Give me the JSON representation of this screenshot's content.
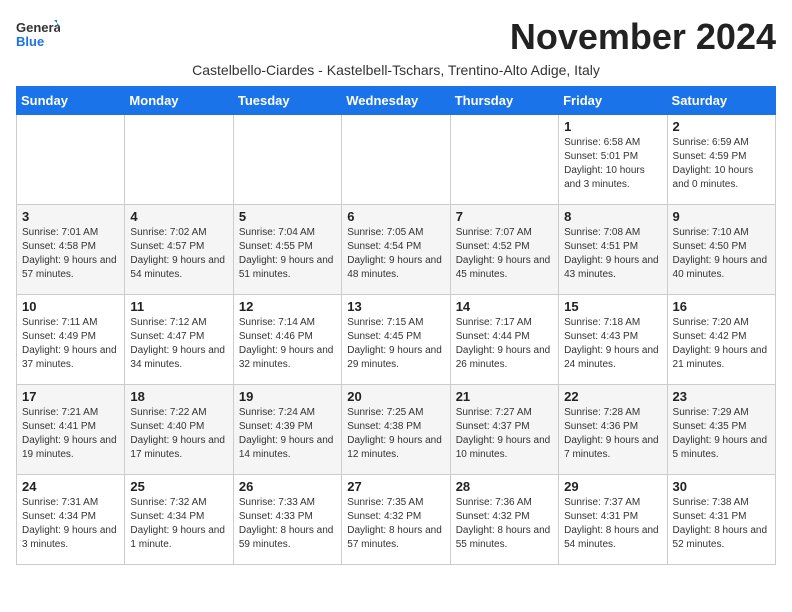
{
  "logo": {
    "text_general": "General",
    "text_blue": "Blue"
  },
  "title": "November 2024",
  "subtitle": "Castelbello-Ciardes - Kastelbell-Tschars, Trentino-Alto Adige, Italy",
  "headers": [
    "Sunday",
    "Monday",
    "Tuesday",
    "Wednesday",
    "Thursday",
    "Friday",
    "Saturday"
  ],
  "weeks": [
    [
      {
        "day": "",
        "info": ""
      },
      {
        "day": "",
        "info": ""
      },
      {
        "day": "",
        "info": ""
      },
      {
        "day": "",
        "info": ""
      },
      {
        "day": "",
        "info": ""
      },
      {
        "day": "1",
        "info": "Sunrise: 6:58 AM\nSunset: 5:01 PM\nDaylight: 10 hours and 3 minutes."
      },
      {
        "day": "2",
        "info": "Sunrise: 6:59 AM\nSunset: 4:59 PM\nDaylight: 10 hours and 0 minutes."
      }
    ],
    [
      {
        "day": "3",
        "info": "Sunrise: 7:01 AM\nSunset: 4:58 PM\nDaylight: 9 hours and 57 minutes."
      },
      {
        "day": "4",
        "info": "Sunrise: 7:02 AM\nSunset: 4:57 PM\nDaylight: 9 hours and 54 minutes."
      },
      {
        "day": "5",
        "info": "Sunrise: 7:04 AM\nSunset: 4:55 PM\nDaylight: 9 hours and 51 minutes."
      },
      {
        "day": "6",
        "info": "Sunrise: 7:05 AM\nSunset: 4:54 PM\nDaylight: 9 hours and 48 minutes."
      },
      {
        "day": "7",
        "info": "Sunrise: 7:07 AM\nSunset: 4:52 PM\nDaylight: 9 hours and 45 minutes."
      },
      {
        "day": "8",
        "info": "Sunrise: 7:08 AM\nSunset: 4:51 PM\nDaylight: 9 hours and 43 minutes."
      },
      {
        "day": "9",
        "info": "Sunrise: 7:10 AM\nSunset: 4:50 PM\nDaylight: 9 hours and 40 minutes."
      }
    ],
    [
      {
        "day": "10",
        "info": "Sunrise: 7:11 AM\nSunset: 4:49 PM\nDaylight: 9 hours and 37 minutes."
      },
      {
        "day": "11",
        "info": "Sunrise: 7:12 AM\nSunset: 4:47 PM\nDaylight: 9 hours and 34 minutes."
      },
      {
        "day": "12",
        "info": "Sunrise: 7:14 AM\nSunset: 4:46 PM\nDaylight: 9 hours and 32 minutes."
      },
      {
        "day": "13",
        "info": "Sunrise: 7:15 AM\nSunset: 4:45 PM\nDaylight: 9 hours and 29 minutes."
      },
      {
        "day": "14",
        "info": "Sunrise: 7:17 AM\nSunset: 4:44 PM\nDaylight: 9 hours and 26 minutes."
      },
      {
        "day": "15",
        "info": "Sunrise: 7:18 AM\nSunset: 4:43 PM\nDaylight: 9 hours and 24 minutes."
      },
      {
        "day": "16",
        "info": "Sunrise: 7:20 AM\nSunset: 4:42 PM\nDaylight: 9 hours and 21 minutes."
      }
    ],
    [
      {
        "day": "17",
        "info": "Sunrise: 7:21 AM\nSunset: 4:41 PM\nDaylight: 9 hours and 19 minutes."
      },
      {
        "day": "18",
        "info": "Sunrise: 7:22 AM\nSunset: 4:40 PM\nDaylight: 9 hours and 17 minutes."
      },
      {
        "day": "19",
        "info": "Sunrise: 7:24 AM\nSunset: 4:39 PM\nDaylight: 9 hours and 14 minutes."
      },
      {
        "day": "20",
        "info": "Sunrise: 7:25 AM\nSunset: 4:38 PM\nDaylight: 9 hours and 12 minutes."
      },
      {
        "day": "21",
        "info": "Sunrise: 7:27 AM\nSunset: 4:37 PM\nDaylight: 9 hours and 10 minutes."
      },
      {
        "day": "22",
        "info": "Sunrise: 7:28 AM\nSunset: 4:36 PM\nDaylight: 9 hours and 7 minutes."
      },
      {
        "day": "23",
        "info": "Sunrise: 7:29 AM\nSunset: 4:35 PM\nDaylight: 9 hours and 5 minutes."
      }
    ],
    [
      {
        "day": "24",
        "info": "Sunrise: 7:31 AM\nSunset: 4:34 PM\nDaylight: 9 hours and 3 minutes."
      },
      {
        "day": "25",
        "info": "Sunrise: 7:32 AM\nSunset: 4:34 PM\nDaylight: 9 hours and 1 minute."
      },
      {
        "day": "26",
        "info": "Sunrise: 7:33 AM\nSunset: 4:33 PM\nDaylight: 8 hours and 59 minutes."
      },
      {
        "day": "27",
        "info": "Sunrise: 7:35 AM\nSunset: 4:32 PM\nDaylight: 8 hours and 57 minutes."
      },
      {
        "day": "28",
        "info": "Sunrise: 7:36 AM\nSunset: 4:32 PM\nDaylight: 8 hours and 55 minutes."
      },
      {
        "day": "29",
        "info": "Sunrise: 7:37 AM\nSunset: 4:31 PM\nDaylight: 8 hours and 54 minutes."
      },
      {
        "day": "30",
        "info": "Sunrise: 7:38 AM\nSunset: 4:31 PM\nDaylight: 8 hours and 52 minutes."
      }
    ]
  ]
}
